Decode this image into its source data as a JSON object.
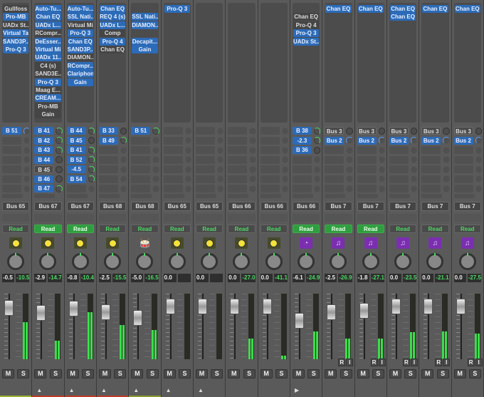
{
  "colors": {
    "accent_blue": "#2c6bb8",
    "read_green": "#2f9e3f",
    "meter_green": "#3ddc4c",
    "purple": "#7b2fb0"
  },
  "strips": [
    {
      "plugins": [
        {
          "t": "Gullfoss",
          "s": "gray"
        },
        {
          "t": "Pro-MB",
          "s": "blue"
        },
        {
          "t": "UADx St...",
          "s": "gray"
        },
        {
          "t": "Virtual Ta",
          "s": "blue"
        },
        {
          "t": "SAND3P...",
          "s": "blue"
        },
        {
          "t": "Pro-Q 3",
          "s": "blue"
        }
      ],
      "sends": [
        {
          "t": "B 51",
          "s": "blue",
          "k": "bl"
        }
      ],
      "output": "Bus 65",
      "read": "Read",
      "read_on": false,
      "icon": "yellow",
      "vol": "-0.5",
      "peak": "-10.5",
      "level": 0.57,
      "fader_db": -0.5,
      "ri": false,
      "mute": "M",
      "solo": "S",
      "arrow": "",
      "bar": "#9ab530"
    },
    {
      "plugins": [
        {
          "t": "Auto-Tu...",
          "s": "blue"
        },
        {
          "t": "Chan EQ",
          "s": "blue"
        },
        {
          "t": "UADx L...",
          "s": "blue"
        },
        {
          "t": "RCompr...",
          "s": "gray"
        },
        {
          "t": "DeEsser...",
          "s": "blue"
        },
        {
          "t": "Virtual Mi",
          "s": "blue"
        },
        {
          "t": "UADx 11...",
          "s": "blue"
        },
        {
          "t": "C4 (s)",
          "s": "gray"
        },
        {
          "t": "SAND3E...",
          "s": "gray"
        },
        {
          "t": "Pro-Q 3",
          "s": "blue"
        },
        {
          "t": "Maag E...",
          "s": "gray"
        },
        {
          "t": "CREAM...",
          "s": "blue"
        },
        {
          "t": "Pro-MB",
          "s": "gray"
        },
        {
          "t": "Gain",
          "s": "gray"
        }
      ],
      "sends": [
        {
          "t": "B 41",
          "s": "blue",
          "k": "on"
        },
        {
          "t": "B 42",
          "s": "blue",
          "k": "on"
        },
        {
          "t": "B 43",
          "s": "blue",
          "k": "on"
        },
        {
          "t": "B 44",
          "s": "blue",
          "k": "dark"
        },
        {
          "t": "B 45",
          "s": "gray",
          "k": "dark"
        },
        {
          "t": "B 46",
          "s": "blue",
          "k": "dark"
        },
        {
          "t": "B 47",
          "s": "blue",
          "k": "on"
        }
      ],
      "output": "Bus 67",
      "read": "Read",
      "read_on": true,
      "icon": "yellow",
      "vol": "-2.9",
      "peak": "-14.7",
      "level": 0.28,
      "fader_db": -2.9,
      "ri": false,
      "mute": "M",
      "solo": "S",
      "arrow": "▲",
      "bar": "#c0392b"
    },
    {
      "plugins": [
        {
          "t": "Auto-Tu...",
          "s": "blue"
        },
        {
          "t": "SSL Nati...",
          "s": "blue"
        },
        {
          "t": "Virtual Mi",
          "s": "gray"
        },
        {
          "t": "Pro-Q 3",
          "s": "blue"
        },
        {
          "t": "Chan EQ",
          "s": "blue"
        },
        {
          "t": "SAND3P...",
          "s": "blue"
        },
        {
          "t": "DIAMON...",
          "s": "gray"
        },
        {
          "t": "RCompr...",
          "s": "blue"
        },
        {
          "t": "Clariphoni",
          "s": "blue"
        },
        {
          "t": "Gain",
          "s": "blue"
        }
      ],
      "sends": [
        {
          "t": "B 44",
          "s": "blue",
          "k": "on"
        },
        {
          "t": "B 45",
          "s": "blue",
          "k": "dark"
        },
        {
          "t": "B 41",
          "s": "blue",
          "k": "on"
        },
        {
          "t": "B 52",
          "s": "blue",
          "k": "on"
        },
        {
          "t": "-4.5",
          "s": "blue",
          "k": "on"
        },
        {
          "t": "B 54",
          "s": "blue",
          "k": "on"
        }
      ],
      "output": "Bus 67",
      "read": "Read",
      "read_on": true,
      "icon": "yellow",
      "vol": "-0.8",
      "peak": "-10.4",
      "level": 0.72,
      "fader_db": -0.8,
      "ri": false,
      "mute": "M",
      "solo": "S",
      "arrow": "▲",
      "bar": "#c0392b"
    },
    {
      "plugins": [
        {
          "t": "Chan EQ",
          "s": "blue"
        },
        {
          "t": "REQ 4 (s)",
          "s": "blue"
        },
        {
          "t": "UADx L...",
          "s": "blue"
        },
        {
          "t": "Comp",
          "s": "gray"
        },
        {
          "t": "Pro-Q 4",
          "s": "blue"
        },
        {
          "t": "Chan EQ",
          "s": "gray"
        }
      ],
      "sends": [
        {
          "t": "B 33",
          "s": "blue",
          "k": "dark"
        },
        {
          "t": "B 49",
          "s": "blue",
          "k": "on"
        }
      ],
      "output": "Bus 68",
      "read": "Read",
      "read_on": false,
      "icon": "yellow",
      "vol": "-2.5",
      "peak": "-15.5",
      "level": 0.52,
      "fader_db": -2.5,
      "ri": false,
      "mute": "M",
      "solo": "S",
      "arrow": "▲",
      "bar": "#c0392b"
    },
    {
      "plugins": [
        {
          "t": "",
          "s": "empty"
        },
        {
          "t": "SSL Nati...",
          "s": "blue"
        },
        {
          "t": "DIAMON...",
          "s": "blue"
        },
        {
          "t": "",
          "s": "empty"
        },
        {
          "t": "Decapit...",
          "s": "blue"
        },
        {
          "t": "Gain",
          "s": "blue"
        }
      ],
      "sends": [
        {
          "t": "B 51",
          "s": "blue",
          "k": "on"
        }
      ],
      "output": "Bus 68",
      "read": "Read",
      "read_on": false,
      "icon": "drum",
      "vol": "-5.0",
      "peak": "-16.5",
      "level": 0.45,
      "fader_db": -5.0,
      "ri": false,
      "mute": "M",
      "solo": "S",
      "arrow": "▲",
      "bar": "#8a9a30"
    },
    {
      "plugins": [
        {
          "t": "Pro-Q 3",
          "s": "blue"
        }
      ],
      "sends": [],
      "output": "Bus 65",
      "read": "Read",
      "read_on": false,
      "icon": "yellow",
      "vol": "0.0",
      "peak": "",
      "level": 0,
      "fader_db": 0,
      "ri": false,
      "mute": "M",
      "solo": "S",
      "arrow": "▲",
      "bar": ""
    },
    {
      "plugins": [],
      "sends": [],
      "output": "Bus 65",
      "read": "Read",
      "read_on": false,
      "icon": "yellow",
      "vol": "0.0",
      "peak": "",
      "level": 0,
      "fader_db": 0,
      "ri": false,
      "mute": "M",
      "solo": "S",
      "arrow": "▲",
      "bar": ""
    },
    {
      "plugins": [],
      "sends": [],
      "output": "Bus 66",
      "read": "Read",
      "read_on": false,
      "icon": "yellow",
      "vol": "0.0",
      "peak": "-27.0",
      "level": 0.32,
      "fader_db": 0,
      "ri": false,
      "mute": "M",
      "solo": "S",
      "arrow": "",
      "bar": ""
    },
    {
      "plugins": [],
      "sends": [],
      "output": "Bus 66",
      "read": "Read",
      "read_on": false,
      "icon": "yellow",
      "vol": "0.0",
      "peak": "-41.1",
      "level": 0.05,
      "fader_db": 0,
      "ri": false,
      "mute": "M",
      "solo": "S",
      "arrow": "",
      "bar": ""
    },
    {
      "plugins": [
        {
          "t": "",
          "s": "empty"
        },
        {
          "t": "Chan EQ",
          "s": "gray"
        },
        {
          "t": "Pro-Q 4",
          "s": "gray"
        },
        {
          "t": "Pro-Q 3",
          "s": "blue"
        },
        {
          "t": "UADx St...",
          "s": "blue"
        }
      ],
      "sends": [
        {
          "t": "B 38",
          "s": "blue",
          "k": "on"
        },
        {
          "t": "-2.3",
          "s": "blue",
          "k": "on"
        },
        {
          "t": "B 36",
          "s": "blue",
          "k": "dark"
        }
      ],
      "output": "Bus 66",
      "read": "Read",
      "read_on": true,
      "icon": "purple-knob",
      "vol": "-6.1",
      "peak": "-24.9",
      "level": 0.42,
      "fader_db": -6.1,
      "ri": false,
      "mute": "M",
      "solo": "S",
      "arrow": "▶",
      "bar": ""
    },
    {
      "plugins": [
        {
          "t": "Chan EQ",
          "s": "blue"
        }
      ],
      "sends": [
        {
          "t": "Bus 3",
          "s": "gray",
          "k": "dark"
        },
        {
          "t": "Bus 2",
          "s": "blue",
          "k": "bl"
        }
      ],
      "output": "Bus 7",
      "read": "Read",
      "read_on": true,
      "icon": "purple-note",
      "vol": "-2.5",
      "peak": "-26.9",
      "level": 0.32,
      "fader_db": -2.5,
      "ri": true,
      "r": "R",
      "i": "I",
      "mute": "M",
      "solo": "S",
      "arrow": "",
      "bar": ""
    },
    {
      "plugins": [
        {
          "t": "Chan EQ",
          "s": "blue"
        }
      ],
      "sends": [
        {
          "t": "Bus 3",
          "s": "gray",
          "k": "dark"
        },
        {
          "t": "Bus 2",
          "s": "blue",
          "k": "bl"
        }
      ],
      "output": "Bus 7",
      "read": "Read",
      "read_on": true,
      "icon": "purple-note",
      "vol": "-1.8",
      "peak": "-27.1",
      "level": 0.32,
      "fader_db": -1.8,
      "ri": true,
      "r": "R",
      "i": "I",
      "mute": "M",
      "solo": "S",
      "arrow": "",
      "bar": ""
    },
    {
      "plugins": [
        {
          "t": "Chan EQ",
          "s": "blue"
        },
        {
          "t": "Chan EQ",
          "s": "blue"
        }
      ],
      "sends": [
        {
          "t": "Bus 3",
          "s": "gray",
          "k": "dark"
        },
        {
          "t": "Bus 2",
          "s": "blue",
          "k": "bl"
        }
      ],
      "output": "Bus 7",
      "read": "Read",
      "read_on": false,
      "icon": "purple-note",
      "vol": "0.0",
      "peak": "-23.5",
      "level": 0.41,
      "fader_db": 0,
      "ri": true,
      "r": "R",
      "i": "I",
      "mute": "M",
      "solo": "S",
      "arrow": "",
      "bar": ""
    },
    {
      "plugins": [
        {
          "t": "Chan EQ",
          "s": "blue"
        }
      ],
      "sends": [
        {
          "t": "Bus 3",
          "s": "gray",
          "k": "dark"
        },
        {
          "t": "Bus 2",
          "s": "blue",
          "k": "bl"
        }
      ],
      "output": "Bus 7",
      "read": "Read",
      "read_on": false,
      "icon": "purple-note",
      "vol": "0.0",
      "peak": "-21.1",
      "level": 0.42,
      "fader_db": 0,
      "ri": true,
      "r": "R",
      "i": "I",
      "mute": "M",
      "solo": "S",
      "arrow": "",
      "bar": ""
    },
    {
      "plugins": [
        {
          "t": "Chan EQ",
          "s": "blue"
        }
      ],
      "sends": [
        {
          "t": "Bus 3",
          "s": "gray",
          "k": "dark"
        },
        {
          "t": "Bus 2",
          "s": "blue",
          "k": "bl"
        }
      ],
      "output": "Bus 7",
      "read": "Read",
      "read_on": false,
      "icon": "purple-note",
      "vol": "0.0",
      "peak": "-27.5",
      "level": 0.39,
      "fader_db": 0,
      "ri": true,
      "r": "R",
      "i": "I",
      "mute": "M",
      "solo": "S",
      "arrow": "",
      "bar": ""
    }
  ]
}
